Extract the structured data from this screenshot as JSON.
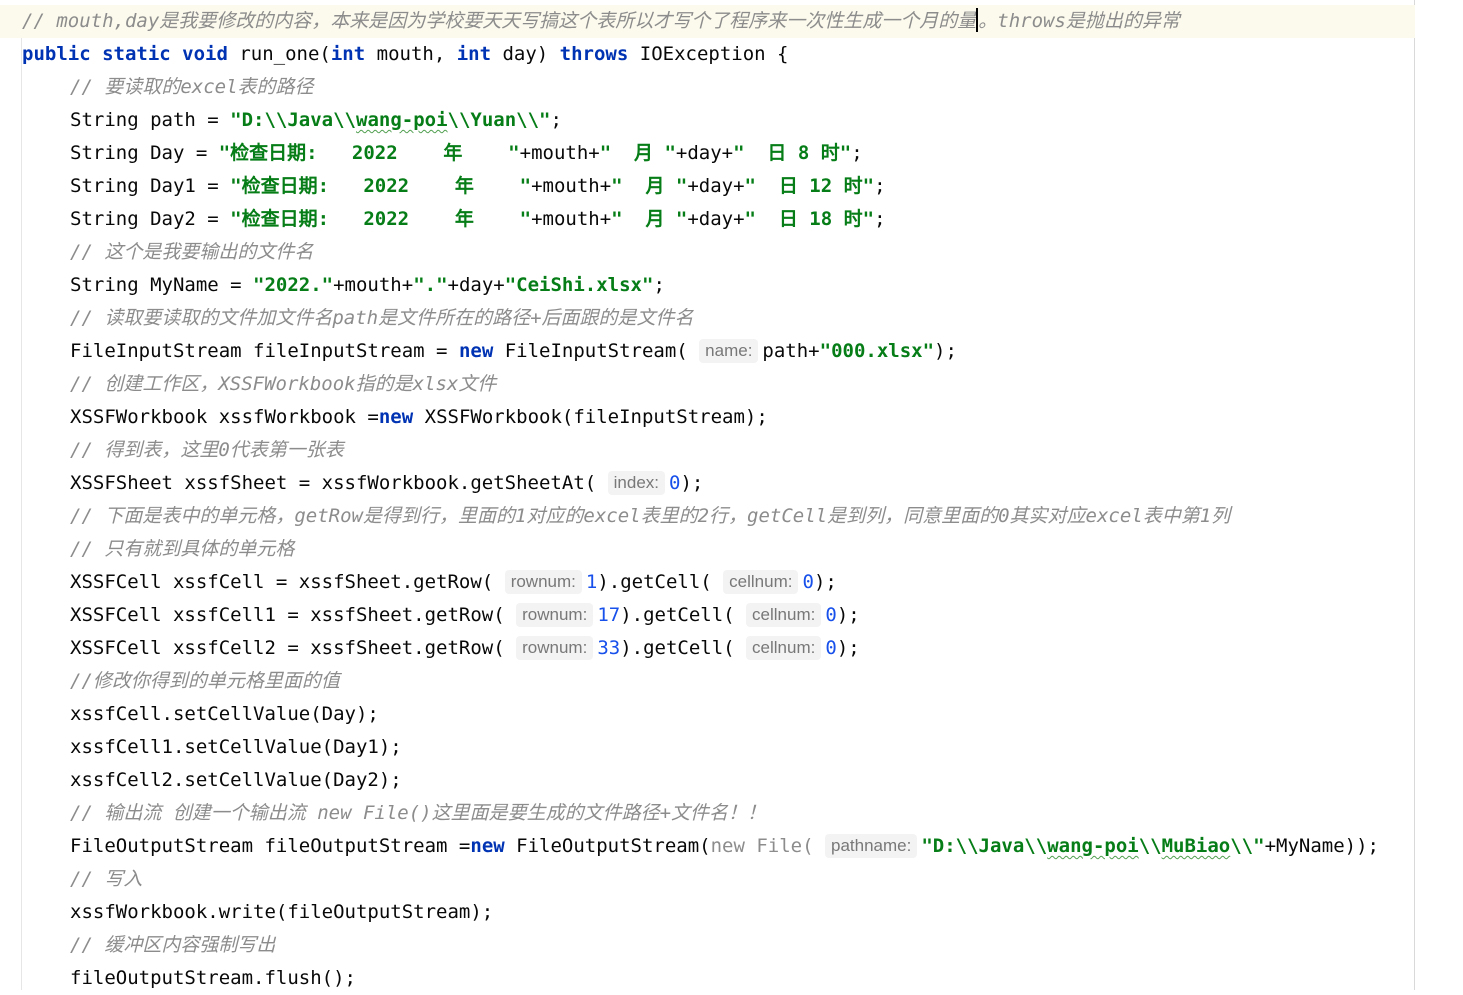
{
  "editor": {
    "lines": [
      {
        "current": true,
        "indent": 22,
        "tokens": [
          {
            "t": "// mouth,day是我要修改的内容，本来是因为学校要天天写搞这个表所以才写个了程序来一次性生成一个月的量",
            "c": "cmt"
          },
          {
            "caret": true
          },
          {
            "t": "。throws是抛出的异常",
            "c": "cmt"
          }
        ]
      },
      {
        "indent": 22,
        "tokens": [
          {
            "t": "public static void ",
            "c": "kw"
          },
          {
            "t": "run_one("
          },
          {
            "t": "int ",
            "c": "kw"
          },
          {
            "t": "mouth, "
          },
          {
            "t": "int ",
            "c": "kw"
          },
          {
            "t": "day) "
          },
          {
            "t": "throws ",
            "c": "kw"
          },
          {
            "t": "IOException {"
          }
        ]
      },
      {
        "indent": 70,
        "tokens": [
          {
            "t": "// 要读取的excel表的路径",
            "c": "cmt"
          }
        ]
      },
      {
        "indent": 70,
        "tokens": [
          {
            "t": "String path = "
          },
          {
            "t": "\"D:\\\\Java\\\\",
            "c": "str"
          },
          {
            "t": "wang-poi",
            "c": "str squig"
          },
          {
            "t": "\\\\Yuan\\\\\"",
            "c": "str"
          },
          {
            "t": ";"
          }
        ]
      },
      {
        "indent": 70,
        "tokens": [
          {
            "t": "String Day = "
          },
          {
            "t": "\"检查日期:   2022    年    \"",
            "c": "str"
          },
          {
            "t": "+mouth+"
          },
          {
            "t": "\"  月 \"",
            "c": "str"
          },
          {
            "t": "+day+"
          },
          {
            "t": "\"  日 8 时\"",
            "c": "str"
          },
          {
            "t": ";"
          }
        ]
      },
      {
        "indent": 70,
        "tokens": [
          {
            "t": "String Day1 = "
          },
          {
            "t": "\"检查日期:   2022    年    \"",
            "c": "str"
          },
          {
            "t": "+mouth+"
          },
          {
            "t": "\"  月 \"",
            "c": "str"
          },
          {
            "t": "+day+"
          },
          {
            "t": "\"  日 12 时\"",
            "c": "str"
          },
          {
            "t": ";"
          }
        ]
      },
      {
        "indent": 70,
        "tokens": [
          {
            "t": "String Day2 = "
          },
          {
            "t": "\"检查日期:   2022    年    \"",
            "c": "str"
          },
          {
            "t": "+mouth+"
          },
          {
            "t": "\"  月 \"",
            "c": "str"
          },
          {
            "t": "+day+"
          },
          {
            "t": "\"  日 18 时\"",
            "c": "str"
          },
          {
            "t": ";"
          }
        ]
      },
      {
        "indent": 70,
        "tokens": [
          {
            "t": "// 这个是我要输出的文件名",
            "c": "cmt"
          }
        ]
      },
      {
        "indent": 70,
        "tokens": [
          {
            "t": "String MyName = "
          },
          {
            "t": "\"2022.\"",
            "c": "str"
          },
          {
            "t": "+mouth+"
          },
          {
            "t": "\".\"",
            "c": "str"
          },
          {
            "t": "+day+"
          },
          {
            "t": "\"CeiShi.xlsx\"",
            "c": "str"
          },
          {
            "t": ";"
          }
        ]
      },
      {
        "indent": 70,
        "tokens": [
          {
            "t": "// 读取要读取的文件加文件名path是文件所在的路径+后面跟的是文件名",
            "c": "cmt"
          }
        ]
      },
      {
        "indent": 70,
        "tokens": [
          {
            "t": "FileInputStream fileInputStream = "
          },
          {
            "t": "new ",
            "c": "kw"
          },
          {
            "t": "FileInputStream( "
          },
          {
            "hint": "name:"
          },
          {
            "t": "path+"
          },
          {
            "t": "\"000.xlsx\"",
            "c": "str"
          },
          {
            "t": ");"
          }
        ]
      },
      {
        "indent": 70,
        "tokens": [
          {
            "t": "// 创建工作区，XSSFWorkbook指的是xlsx文件",
            "c": "cmt"
          }
        ]
      },
      {
        "indent": 70,
        "tokens": [
          {
            "t": "XSSFWorkbook xssfWorkbook ="
          },
          {
            "t": "new ",
            "c": "kw"
          },
          {
            "t": "XSSFWorkbook(fileInputStream);"
          }
        ]
      },
      {
        "indent": 70,
        "tokens": [
          {
            "t": "// 得到表，这里0代表第一张表",
            "c": "cmt"
          }
        ]
      },
      {
        "indent": 70,
        "tokens": [
          {
            "t": "XSSFSheet xssfSheet = xssfWorkbook.getSheetAt( "
          },
          {
            "hint": "index:"
          },
          {
            "t": "0",
            "c": "num"
          },
          {
            "t": ");"
          }
        ]
      },
      {
        "indent": 70,
        "tokens": [
          {
            "t": "// 下面是表中的单元格，getRow是得到行，里面的1对应的excel表里的2行，getCell是到列，同意里面的0其实对应excel表中第1列",
            "c": "cmt"
          }
        ]
      },
      {
        "indent": 70,
        "tokens": [
          {
            "t": "// 只有就到具体的单元格",
            "c": "cmt"
          }
        ]
      },
      {
        "indent": 70,
        "tokens": [
          {
            "t": "XSSFCell xssfCell = xssfSheet.getRow( "
          },
          {
            "hint": "rownum:"
          },
          {
            "t": "1",
            "c": "num"
          },
          {
            "t": ").getCell( "
          },
          {
            "hint": "cellnum:"
          },
          {
            "t": "0",
            "c": "num"
          },
          {
            "t": ");"
          }
        ]
      },
      {
        "indent": 70,
        "tokens": [
          {
            "t": "XSSFCell xssfCell1 = xssfSheet.getRow( "
          },
          {
            "hint": "rownum:"
          },
          {
            "t": "17",
            "c": "num"
          },
          {
            "t": ").getCell( "
          },
          {
            "hint": "cellnum:"
          },
          {
            "t": "0",
            "c": "num"
          },
          {
            "t": ");"
          }
        ]
      },
      {
        "indent": 70,
        "tokens": [
          {
            "t": "XSSFCell xssfCell2 = xssfSheet.getRow( "
          },
          {
            "hint": "rownum:"
          },
          {
            "t": "33",
            "c": "num"
          },
          {
            "t": ").getCell( "
          },
          {
            "hint": "cellnum:"
          },
          {
            "t": "0",
            "c": "num"
          },
          {
            "t": ");"
          }
        ]
      },
      {
        "indent": 70,
        "tokens": [
          {
            "t": "//修改你得到的单元格里面的值",
            "c": "cmt"
          }
        ]
      },
      {
        "indent": 70,
        "tokens": [
          {
            "t": "xssfCell.setCellValue(Day);"
          }
        ]
      },
      {
        "indent": 70,
        "tokens": [
          {
            "t": "xssfCell1.setCellValue(Day1);"
          }
        ]
      },
      {
        "indent": 70,
        "tokens": [
          {
            "t": "xssfCell2.setCellValue(Day2);"
          }
        ]
      },
      {
        "indent": 70,
        "tokens": [
          {
            "t": "// 输出流 创建一个输出流 new File()这里面是要生成的文件路径+文件名！！",
            "c": "cmt"
          }
        ]
      },
      {
        "indent": 70,
        "tokens": [
          {
            "t": "FileOutputStream fileOutputStream ="
          },
          {
            "t": "new ",
            "c": "kw"
          },
          {
            "t": "FileOutputStream("
          },
          {
            "t": "new File( ",
            "c": "gray"
          },
          {
            "hint": "pathname:"
          },
          {
            "t": "\"D:\\\\Java\\\\",
            "c": "str"
          },
          {
            "t": "wang-poi",
            "c": "str squig"
          },
          {
            "t": "\\\\",
            "c": "str"
          },
          {
            "t": "MuBiao",
            "c": "str squig"
          },
          {
            "t": "\\\\\"",
            "c": "str"
          },
          {
            "t": "+MyName));"
          }
        ]
      },
      {
        "indent": 70,
        "tokens": [
          {
            "t": "// 写入",
            "c": "cmt"
          }
        ]
      },
      {
        "indent": 70,
        "tokens": [
          {
            "t": "xssfWorkbook.write(fileOutputStream);"
          }
        ]
      },
      {
        "indent": 70,
        "tokens": [
          {
            "t": "// 缓冲区内容强制写出",
            "c": "cmt"
          }
        ]
      },
      {
        "indent": 70,
        "tokens": [
          {
            "t": "fileOutputStream.flush();"
          }
        ]
      }
    ]
  }
}
